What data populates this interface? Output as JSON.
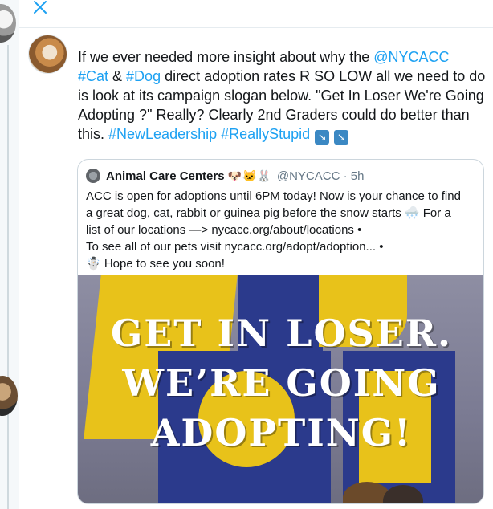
{
  "tweet": {
    "text_intro": "If we ever needed more insight about why the ",
    "mention": "@NYCACC",
    "line2_hashtag_cat": "#Cat",
    "line2_amp": " & ",
    "line2_hashtag_dog": "#Dog",
    "line2_rest": " direct adoption rates R SO LOW all we need to do is look at its campaign slogan below.  \"Get In Loser We're Going Adopting ?\" Really?  Clearly 2nd Graders could do better than this. ",
    "hashtag_newleadership": "#NewLeadership",
    "hashtag_reallystupid": "#ReallyStupid",
    "arrow_glyph": "↘"
  },
  "quote": {
    "name": "Animal Care Centers",
    "name_emojis": "🐶🐱🐰",
    "handle_time": "@NYCACC · 5h",
    "line1": "ACC is open for adoptions until 6PM today! Now is your chance to find",
    "line2": "a great dog, cat, rabbit or guinea pig before the snow starts 🌨️ For a",
    "line3": "list of our locations —> nycacc.org/about/locations •",
    "line4": "To see all of our pets visit nycacc.org/adopt/adoption... •",
    "line5": "☃️ Hope to see you soon!"
  },
  "media": {
    "line1": "GET IN LOSER.",
    "line2": "WE’RE GOING",
    "line3": "ADOPTING!"
  },
  "colors": {
    "link": "#1da1f2",
    "banner_yellow": "#e8c21a",
    "banner_blue": "#2b3a8c"
  }
}
